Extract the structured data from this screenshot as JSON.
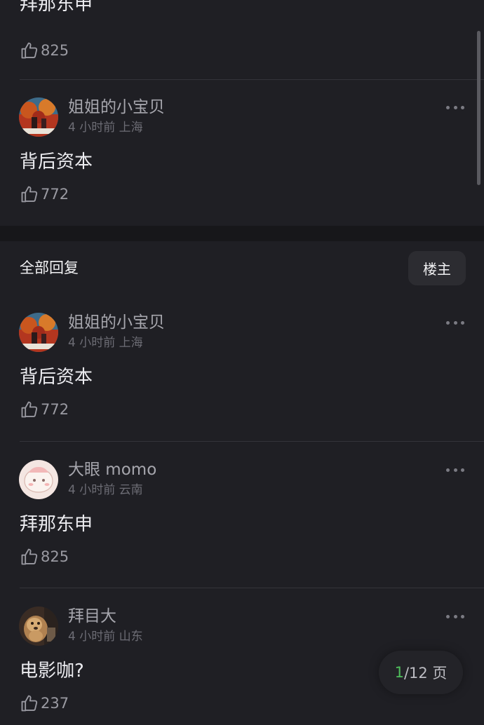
{
  "top_fragment": {
    "text": "拜那东申",
    "likes": "825"
  },
  "preview_comment": {
    "name": "姐姐的小宝贝",
    "meta": "4 小时前 上海",
    "text": "背后资本",
    "likes": "772"
  },
  "replies_section": {
    "title": "全部回复",
    "filter_button": "楼主"
  },
  "comments": [
    {
      "name": "姐姐的小宝贝",
      "meta": "4 小时前 上海",
      "text": "背后资本",
      "likes": "772",
      "avatar": "avatar-red-leaves"
    },
    {
      "name": "大眼 momo",
      "meta": "4 小时前 云南",
      "text": "拜那东申",
      "likes": "825",
      "avatar": "avatar-cartoon-pink"
    },
    {
      "name": "拜目大",
      "meta": "4 小时前 山东",
      "text": "电影咖?",
      "likes": "237",
      "avatar": "avatar-dog-photo"
    }
  ],
  "pagination": {
    "current": "1",
    "total": "/12 页"
  },
  "icons": {
    "like": "thumbs-up-icon",
    "more": "more-dots-icon"
  },
  "colors": {
    "background": "#1f1f24",
    "accent_green": "#4fbf5c"
  }
}
